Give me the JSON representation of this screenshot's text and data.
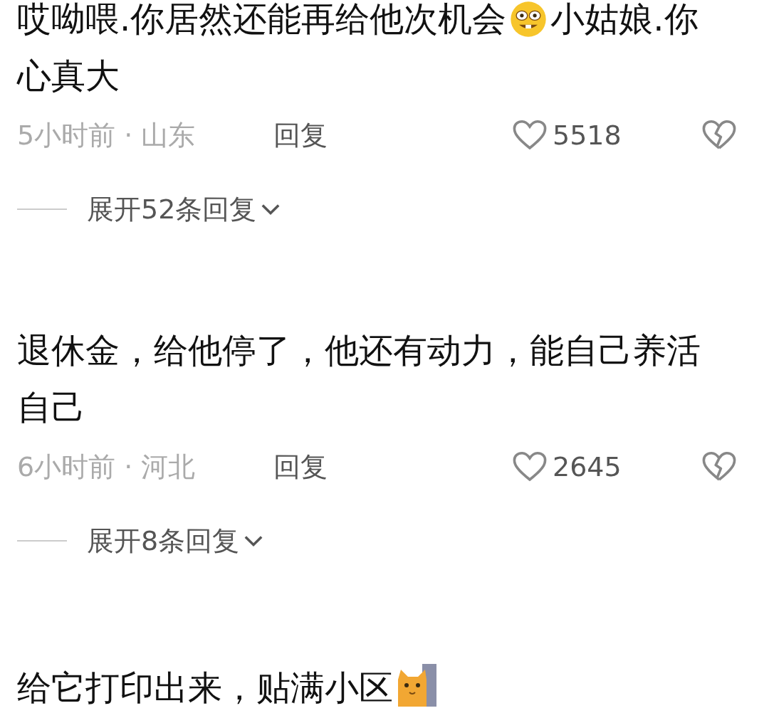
{
  "comments": [
    {
      "segments": [
        {
          "kind": "text",
          "text": "哎呦喂.你居然还能再给他次机会"
        },
        {
          "kind": "smiley"
        },
        {
          "kind": "text",
          "text": "小姑娘.你心真大"
        }
      ],
      "time_place": "5小时前 · 山东",
      "reply": "回复",
      "likes": "5518",
      "expand": "展开52条回复"
    },
    {
      "segments": [
        {
          "kind": "text",
          "text": "退休金，给他停了，他还有动力，能自己养活自己"
        }
      ],
      "time_place": "6小时前 · 河北",
      "reply": "回复",
      "likes": "2645",
      "expand": "展开8条回复"
    },
    {
      "segments": [
        {
          "kind": "text",
          "text": "给它打印出来，贴满小区"
        },
        {
          "kind": "cat"
        }
      ]
    }
  ]
}
